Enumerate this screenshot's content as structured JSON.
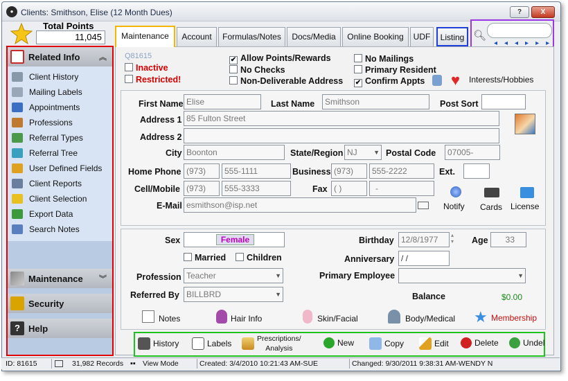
{
  "window": {
    "title": "Clients: Smithson, Elise (12 Month Dues)",
    "help_btn": "?",
    "close_btn": "X",
    "min_btn": "_"
  },
  "points": {
    "label": "Total Points",
    "value": "11,045"
  },
  "sidebar": {
    "related_header": "Related Info",
    "items": [
      {
        "label": "Client History",
        "icon": "history-icon"
      },
      {
        "label": "Mailing Labels",
        "icon": "labels-icon"
      },
      {
        "label": "Appointments",
        "icon": "calendar-icon"
      },
      {
        "label": "Professions",
        "icon": "person-icon"
      },
      {
        "label": "Referral Types",
        "icon": "referral-icon"
      },
      {
        "label": "Referral Tree",
        "icon": "tree-icon"
      },
      {
        "label": "User Defined Fields",
        "icon": "pencil-icon"
      },
      {
        "label": "Client Reports",
        "icon": "report-icon"
      },
      {
        "label": "Client Selection",
        "icon": "funnel-icon"
      },
      {
        "label": "Export Data",
        "icon": "export-icon"
      },
      {
        "label": "Search Notes",
        "icon": "search-notes-icon"
      }
    ],
    "maintenance": "Maintenance",
    "security": "Security",
    "help": "Help"
  },
  "tabs": [
    "Maintenance",
    "Account",
    "Formulas/Notes",
    "Docs/Media",
    "Online Booking",
    "UDF",
    "Listing"
  ],
  "search": {
    "placeholder": ""
  },
  "header": {
    "client_code": "Q81615",
    "inactive": "Inactive",
    "restricted": "Restricted!",
    "allow_points": "Allow Points/Rewards",
    "no_checks": "No Checks",
    "non_deliverable": "Non-Deliverable Address",
    "no_mailings": "No Mailings",
    "primary_resident": "Primary Resident",
    "confirm_appts": "Confirm Appts",
    "interests": "Interests/Hobbies"
  },
  "contact": {
    "first_name_label": "First Name",
    "first_name": "Elise",
    "last_name_label": "Last Name",
    "last_name": "Smithson",
    "post_sort_label": "Post Sort",
    "post_sort": "",
    "address1_label": "Address 1",
    "address1": "85 Fulton Street",
    "address2_label": "Address 2",
    "address2": "",
    "city_label": "City",
    "city": "Boonton",
    "state_label": "State/Region",
    "state": "NJ",
    "postal_label": "Postal Code",
    "postal": "07005-",
    "home_phone_label": "Home Phone",
    "home_area": "(973)",
    "home_num": "555-1111",
    "business_label": "Business",
    "bus_area": "(973)",
    "bus_num": "555-2222",
    "ext_label": "Ext.",
    "ext": "",
    "cell_label": "Cell/Mobile",
    "cell_area": "(973)",
    "cell_num": "555-3333",
    "fax_label": "Fax",
    "fax_area": "(  )",
    "fax_num": "-",
    "email_label": "E-Mail",
    "email": "esmithson@isp.net",
    "notify": "Notify",
    "cards": "Cards",
    "license": "License"
  },
  "profile": {
    "sex_label": "Sex",
    "sex": "Female",
    "birthday_label": "Birthday",
    "birthday": "12/8/1977",
    "age_label": "Age",
    "age": "33",
    "married": "Married",
    "children": "Children",
    "anniversary_label": "Anniversary",
    "anniversary": " /  /",
    "profession_label": "Profession",
    "profession": "Teacher",
    "primary_employee_label": "Primary Employee",
    "primary_employee": "",
    "referred_label": "Referred By",
    "referred": "BILLBRD",
    "balance_label": "Balance",
    "balance": "$0.00",
    "notes": "Notes",
    "hair_info": "Hair Info",
    "skin": "Skin/Facial",
    "body": "Body/Medical",
    "membership": "Membership"
  },
  "toolbar": {
    "history": "History",
    "labels": "Labels",
    "prescriptions": "Prescriptions/\nAnalysis",
    "new": "New",
    "copy": "Copy",
    "edit": "Edit",
    "delete": "Delete",
    "undel": "Undel"
  },
  "status": {
    "id": "ID: 81615",
    "records": "31,982 Records",
    "mode": "View Mode",
    "created": "Created: 3/4/2010 10:21:43 AM-SUE",
    "changed": "Changed: 9/30/2011 9:38:31 AM-WENDY N"
  }
}
